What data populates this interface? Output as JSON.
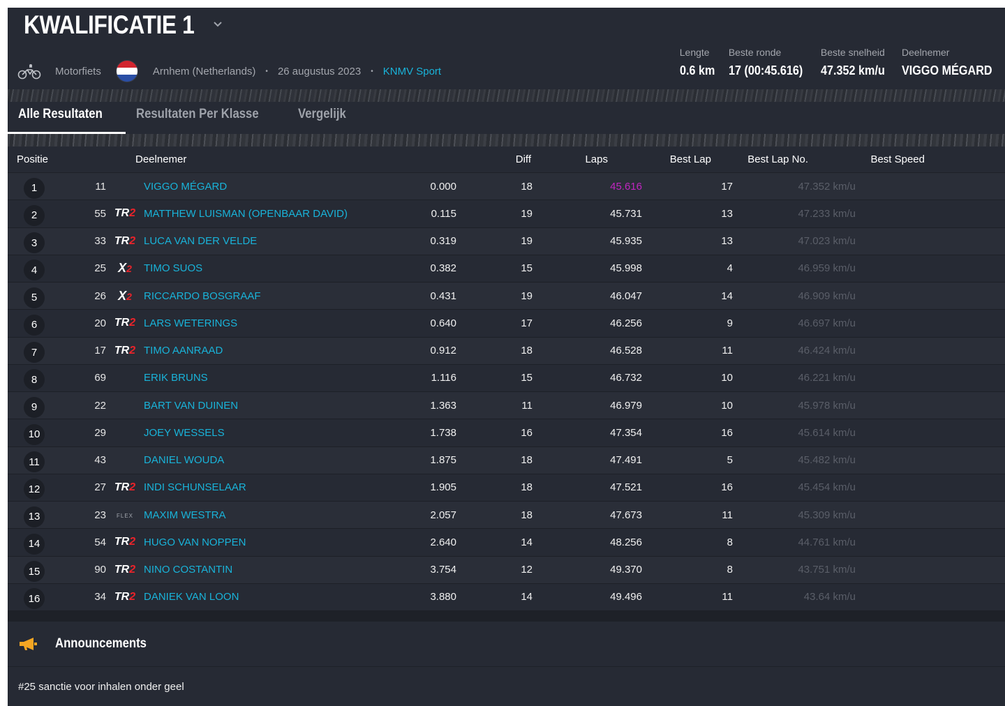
{
  "header": {
    "title": "KWALIFICATIE 1",
    "category": "Motorfiets",
    "location": "Arnhem (Netherlands)",
    "date": "26 augustus 2023",
    "organizer": "KNMV Sport",
    "separator": "•"
  },
  "stats": [
    {
      "label": "Lengte",
      "value": "0.6 km"
    },
    {
      "label": "Beste ronde",
      "value": "17 (00:45.616)"
    },
    {
      "label": "Beste snelheid",
      "value": "47.352 km/u"
    },
    {
      "label": "Deelnemer",
      "value": "VIGGO MÉGARD"
    }
  ],
  "tabs": [
    "Alle Resultaten",
    "Resultaten Per Klasse",
    "Vergelijk"
  ],
  "table": {
    "headers": {
      "position": "Positie",
      "participant": "Deelnemer",
      "diff": "Diff",
      "laps": "Laps",
      "best_lap": "Best Lap",
      "best_lap_no": "Best Lap No.",
      "best_speed": "Best Speed"
    },
    "rows": [
      {
        "pos": "1",
        "num": "11",
        "cls": "",
        "name": "VIGGO MÉGARD",
        "diff": "0.000",
        "laps": "18",
        "best": "45.616",
        "lapno": "17",
        "speed": "47.352 km/u"
      },
      {
        "pos": "2",
        "num": "55",
        "cls": "TR2",
        "name": "MATTHEW LUISMAN (OPENBAAR DAVID)",
        "diff": "0.115",
        "laps": "19",
        "best": "45.731",
        "lapno": "13",
        "speed": "47.233 km/u"
      },
      {
        "pos": "3",
        "num": "33",
        "cls": "TR2",
        "name": "LUCA VAN DER VELDE",
        "diff": "0.319",
        "laps": "19",
        "best": "45.935",
        "lapno": "13",
        "speed": "47.023 km/u"
      },
      {
        "pos": "4",
        "num": "25",
        "cls": "X2",
        "name": "TIMO SUOS",
        "diff": "0.382",
        "laps": "15",
        "best": "45.998",
        "lapno": "4",
        "speed": "46.959 km/u"
      },
      {
        "pos": "5",
        "num": "26",
        "cls": "X2",
        "name": "RICCARDO BOSGRAAF",
        "diff": "0.431",
        "laps": "19",
        "best": "46.047",
        "lapno": "14",
        "speed": "46.909 km/u"
      },
      {
        "pos": "6",
        "num": "20",
        "cls": "TR2",
        "name": "LARS WETERINGS",
        "diff": "0.640",
        "laps": "17",
        "best": "46.256",
        "lapno": "9",
        "speed": "46.697 km/u"
      },
      {
        "pos": "7",
        "num": "17",
        "cls": "TR2",
        "name": "TIMO AANRAAD",
        "diff": "0.912",
        "laps": "18",
        "best": "46.528",
        "lapno": "11",
        "speed": "46.424 km/u"
      },
      {
        "pos": "8",
        "num": "69",
        "cls": "",
        "name": "ERIK BRUNS",
        "diff": "1.116",
        "laps": "15",
        "best": "46.732",
        "lapno": "10",
        "speed": "46.221 km/u"
      },
      {
        "pos": "9",
        "num": "22",
        "cls": "",
        "name": "BART VAN DUINEN",
        "diff": "1.363",
        "laps": "11",
        "best": "46.979",
        "lapno": "10",
        "speed": "45.978 km/u"
      },
      {
        "pos": "10",
        "num": "29",
        "cls": "",
        "name": "JOEY WESSELS",
        "diff": "1.738",
        "laps": "16",
        "best": "47.354",
        "lapno": "16",
        "speed": "45.614 km/u"
      },
      {
        "pos": "11",
        "num": "43",
        "cls": "",
        "name": "DANIEL WOUDA",
        "diff": "1.875",
        "laps": "18",
        "best": "47.491",
        "lapno": "5",
        "speed": "45.482 km/u"
      },
      {
        "pos": "12",
        "num": "27",
        "cls": "TR2",
        "name": "INDI SCHUNSELAAR",
        "diff": "1.905",
        "laps": "18",
        "best": "47.521",
        "lapno": "16",
        "speed": "45.454 km/u"
      },
      {
        "pos": "13",
        "num": "23",
        "cls": "FLEX",
        "name": "MAXIM WESTRA",
        "diff": "2.057",
        "laps": "18",
        "best": "47.673",
        "lapno": "11",
        "speed": "45.309 km/u"
      },
      {
        "pos": "14",
        "num": "54",
        "cls": "TR2",
        "name": "HUGO VAN NOPPEN",
        "diff": "2.640",
        "laps": "14",
        "best": "48.256",
        "lapno": "8",
        "speed": "44.761 km/u"
      },
      {
        "pos": "15",
        "num": "90",
        "cls": "TR2",
        "name": "NINO COSTANTIN",
        "diff": "3.754",
        "laps": "12",
        "best": "49.370",
        "lapno": "8",
        "speed": "43.751 km/u"
      },
      {
        "pos": "16",
        "num": "34",
        "cls": "TR2",
        "name": "DANIEK VAN LOON",
        "diff": "3.880",
        "laps": "14",
        "best": "49.496",
        "lapno": "11",
        "speed": "43.64 km/u"
      }
    ]
  },
  "announcements": {
    "title": "Announcements",
    "message": "#25 sanctie voor inhalen onder geel"
  },
  "colors": {
    "background": "#262a34",
    "link": "#19b3d9",
    "best_lap_highlight": "#c026c0",
    "class_accent": "#e8232a",
    "announcement_icon": "#f5a623"
  },
  "icons": {
    "category": "motorcycle-icon",
    "flag": "netherlands-flag-icon",
    "dropdown": "chevron-down-icon",
    "announcement": "megaphone-icon"
  }
}
